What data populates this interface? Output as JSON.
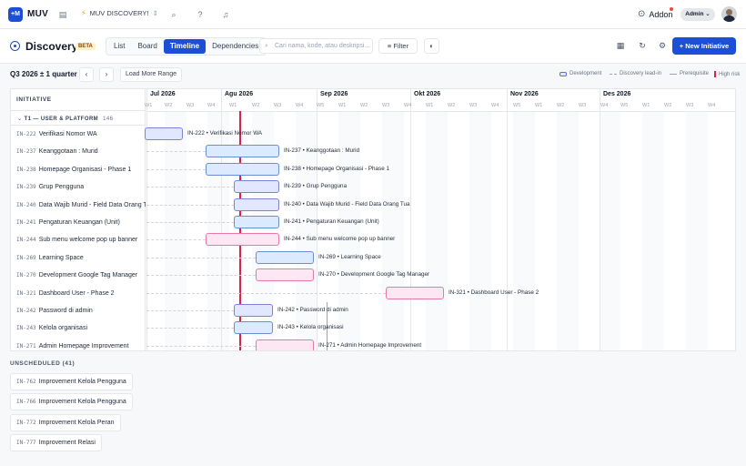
{
  "topbar": {
    "brand": "MUV",
    "logo_text": "+M",
    "workspace": "MUV DISCOVERY!",
    "addon_label": "Addon",
    "user_role": "Admin"
  },
  "header": {
    "title": "Discovery",
    "beta_badge": "BETA",
    "tabs": [
      "List",
      "Board",
      "Timeline",
      "Dependencies"
    ],
    "active_tab": "Timeline",
    "search_placeholder": "Cari nama, kode, atau deskripsi...",
    "filter_label": "Filter",
    "new_button_label": "New Initiative"
  },
  "range": {
    "label": "Q3 2026 ± 1 quarter",
    "load_more_label": "Load More Range"
  },
  "legend": {
    "development": "Development",
    "lead_in": "Discovery lead-in",
    "prerequisite": "Prerequisite",
    "high_risk": "High risk"
  },
  "timeline": {
    "column_header": "INITIATIVE",
    "group_label": "T1 — USER & PLATFORM",
    "group_count": "146",
    "months": [
      "Jul 2026",
      "Agu 2026",
      "Sep 2026",
      "Okt 2026",
      "Nov 2026",
      "Des 2026"
    ],
    "weeks": [
      "W1",
      "W2",
      "W3",
      "W4",
      "W1",
      "W2",
      "W3",
      "W4",
      "W5",
      "W1",
      "W2",
      "W3",
      "W4",
      "W1",
      "W2",
      "W3",
      "W4",
      "W5",
      "W1",
      "W2",
      "W3",
      "W4",
      "W5",
      "W1",
      "W2",
      "W3",
      "W4"
    ],
    "rows": [
      {
        "key": "IN-222",
        "name": "Verifikasi Nomor WA",
        "bar_label": "IN-222 • Verifikasi Nomor WA",
        "color": "dev2"
      },
      {
        "key": "IN-237",
        "name": "Keanggotaan : Murid",
        "bar_label": "IN-237 • Keanggotaan : Murid",
        "color": "dev"
      },
      {
        "key": "IN-238",
        "name": "Homepage Organisasi - Phase 1",
        "bar_label": "IN-238 • Homepage Organisasi - Phase 1",
        "color": "dev"
      },
      {
        "key": "IN-239",
        "name": "Grup Pengguna",
        "bar_label": "IN-239 • Grup Pengguna",
        "color": "dev2"
      },
      {
        "key": "IN-240",
        "name": "Data Wajib Murid - Field Data Orang Tua",
        "bar_label": "IN-240 • Data Wajib Murid - Field Data Orang Tua",
        "color": "dev2"
      },
      {
        "key": "IN-241",
        "name": "Pengaturan Keuangan (Unit)",
        "bar_label": "IN-241 • Pengaturan Keuangan (Unit)",
        "color": "dev"
      },
      {
        "key": "IN-244",
        "name": "Sub menu welcome pop up banner",
        "bar_label": "IN-244 • Sub menu welcome pop up banner",
        "color": "pink"
      },
      {
        "key": "IN-269",
        "name": "Learning Space",
        "bar_label": "IN-269 • Learning Space",
        "color": "dev"
      },
      {
        "key": "IN-270",
        "name": "Development Google Tag Manager",
        "bar_label": "IN-270 • Development Google Tag Manager",
        "color": "pink"
      },
      {
        "key": "IN-321",
        "name": "Dashboard User - Phase 2",
        "bar_label": "IN-321 • Dashboard User - Phase 2",
        "color": "pink"
      },
      {
        "key": "IN-242",
        "name": "Password di admin",
        "bar_label": "IN-242 • Password di admin",
        "color": "dev2"
      },
      {
        "key": "IN-243",
        "name": "Kelola organisasi",
        "bar_label": "IN-243 • Kelola organisasi",
        "color": "dev"
      },
      {
        "key": "IN-271",
        "name": "Admin Homepage Improvement",
        "bar_label": "IN-271 • Admin Homepage Improvement",
        "color": "pink"
      }
    ]
  },
  "unscheduled": {
    "title": "UNSCHEDULED (41)",
    "items": [
      {
        "key": "IN-762",
        "name": "Improvement Kelola Pengguna"
      },
      {
        "key": "IN-766",
        "name": "Improvement Kelola Pengguna"
      },
      {
        "key": "IN-772",
        "name": "Improvement Kelola Peran"
      },
      {
        "key": "IN-777",
        "name": "Improvement Relasi"
      }
    ]
  },
  "colors": {
    "accent": "#1d4ed8",
    "today_line": "#e11d48",
    "dev_fill": "#dbeafe",
    "pink_fill": "#fce7f3"
  }
}
